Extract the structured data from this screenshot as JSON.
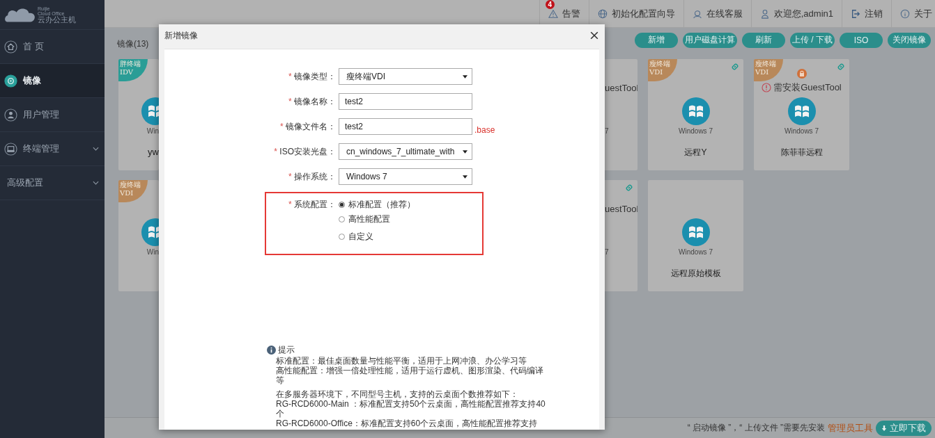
{
  "brand": {
    "lines": [
      "Ruijie",
      "Cloud Office",
      "云办公主机"
    ]
  },
  "sidebar": {
    "items": [
      {
        "label": "首 页",
        "selected": false,
        "expandable": false
      },
      {
        "label": "镜像",
        "selected": true,
        "expandable": false
      },
      {
        "label": "用户管理",
        "selected": false,
        "expandable": false
      },
      {
        "label": "终端管理",
        "selected": false,
        "expandable": true
      },
      {
        "label": "高级配置",
        "selected": false,
        "expandable": true
      }
    ]
  },
  "topbar": {
    "items": [
      {
        "label": "告警",
        "badge": "4"
      },
      {
        "label": "初始化配置向导"
      },
      {
        "label": "在线客服"
      },
      {
        "label": "欢迎您,admin1"
      },
      {
        "label": "注销"
      },
      {
        "label": "关于"
      }
    ]
  },
  "page": {
    "title": "镜像(13)",
    "toolbar": [
      "新增",
      "用户磁盘计算",
      "刷新",
      "上传 / 下载",
      "ISO",
      "关闭镜像"
    ]
  },
  "card_rows": [
    [
      {
        "kind": "edge-left",
        "tag": {
          "lines": [
            "胖终端",
            "IDV"
          ],
          "color": "#2a9d96"
        },
        "linked": false,
        "locked": false,
        "os": "Win",
        "name": "yw"
      },
      {
        "kind": "edge-right",
        "linked": false,
        "locked": false,
        "warning": "uestTool",
        "os": "7"
      },
      {
        "kind": "full",
        "tag": {
          "lines": [
            "瘦终端",
            "VDI"
          ],
          "color": "#b8885a"
        },
        "linked": true,
        "locked": false,
        "os": "Windows 7",
        "name": "远程Y"
      },
      {
        "kind": "full",
        "tag": {
          "lines": [
            "瘦终端",
            "VDI"
          ],
          "color": "#b8885a"
        },
        "linked": true,
        "locked": true,
        "warning": "需安装GuestTool",
        "os": "Windows 7",
        "name": "陈菲菲远程"
      }
    ],
    [
      {
        "kind": "edge-left",
        "tag": {
          "lines": [
            "瘦终端",
            "VDI"
          ],
          "color": "#b8885a"
        },
        "linked": false,
        "locked": false,
        "os": "Win"
      },
      {
        "kind": "edge-right",
        "linked": true,
        "locked": false,
        "warning": "uestTool",
        "os": "7"
      },
      {
        "kind": "full",
        "linked": false,
        "locked": false,
        "os": "Windows 7",
        "name": "远程原始模板"
      }
    ]
  ],
  "footer": {
    "text": "“ 启动镜像 ”，“ 上传文件 ”需要先安装",
    "link": "管理员工具",
    "button": "立即下载"
  },
  "dialog": {
    "title": "新增镜像",
    "fields": [
      {
        "kind": "select",
        "mark": "*",
        "label": "镜像类型：",
        "value": "瘦终端VDI"
      },
      {
        "kind": "text",
        "mark": "*",
        "label": "镜像名称：",
        "value": "test2"
      },
      {
        "kind": "text",
        "mark": "*",
        "label": "镜像文件名：",
        "value": "test2",
        "suffix": ".base"
      },
      {
        "kind": "select",
        "mark": "*",
        "label": "ISO安装光盘：",
        "value": "cn_windows_7_ultimate_with"
      },
      {
        "kind": "select",
        "mark": "*",
        "label": "操作系统：",
        "value": "Windows 7"
      },
      {
        "kind": "radio",
        "mark": "*",
        "label": "系统配置：",
        "highlighted": true,
        "options": [
          {
            "label": "标准配置（推荐）",
            "selected": true
          },
          {
            "label": "高性能配置",
            "selected": false
          },
          {
            "label": "自定义",
            "selected": false
          }
        ]
      }
    ],
    "hint": {
      "title": "提示",
      "lines": [
        "标准配置：最佳桌面数量与性能平衡，适用于上网冲浪、办公学习等",
        "高性能配置：增强一倍处理性能，适用于运行虚机、图形渲染、代码编译等",
        "在多服务器环境下，不同型号主机，支持的云桌面个数推荐如下：",
        "RG-RCD6000-Main ：标准配置支持50个云桌面，高性能配置推荐支持40个",
        "RG-RCD6000-Office：标准配置支持60个云桌面，高性能配置推荐支持"
      ]
    }
  }
}
